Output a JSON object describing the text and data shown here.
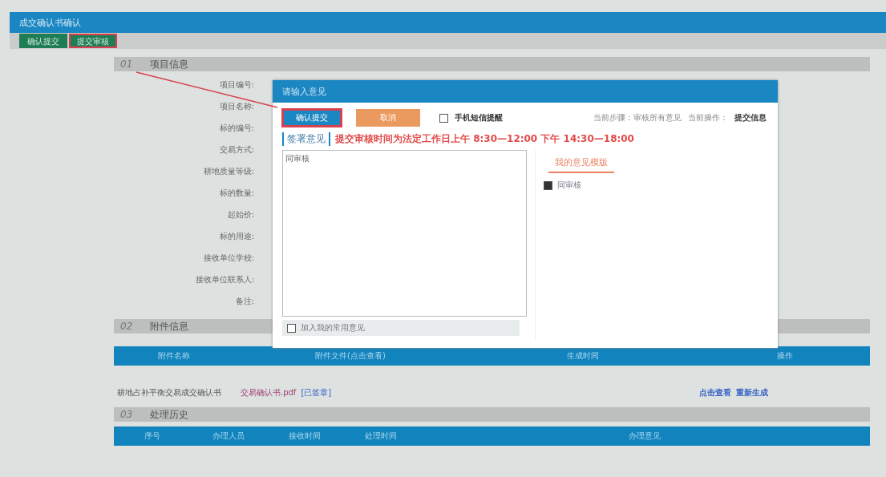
{
  "window": {
    "title": "成交确认书确认"
  },
  "toolbar": {
    "buttons": [
      {
        "label": "确认提交",
        "highlighted": false
      },
      {
        "label": "提交审核",
        "highlighted": true
      }
    ]
  },
  "project_info": {
    "number": "01",
    "title": "项目信息",
    "fields": [
      "项目编号:",
      "项目名称:",
      "标的编号:",
      "交易方式:",
      "耕地质量等级:",
      "标的数量:",
      "起始价:",
      "标的用途:",
      "接收单位学校:",
      "接收单位联系人:",
      "备注:"
    ]
  },
  "attachments": {
    "number": "02",
    "title": "附件信息",
    "columns": [
      "附件名称",
      "附件文件(点击查看)",
      "生成时间",
      "操作"
    ],
    "rows": [
      {
        "name": "耕地占补平衡交易成交确认书",
        "file": "交易确认书.pdf",
        "status": "[已签章]",
        "actions": [
          "点击查看",
          "重新生成"
        ]
      }
    ]
  },
  "history": {
    "number": "03",
    "title": "处理历史",
    "columns": [
      "序号",
      "办理人员",
      "接收时间",
      "处理时间",
      "办理意见"
    ]
  },
  "dialog": {
    "title": "请输入意见",
    "buttons": [
      {
        "label": "确认提交",
        "kind": "primary",
        "highlighted": true
      },
      {
        "label": "取消",
        "kind": "cancel",
        "highlighted": false
      }
    ],
    "sms_reminder": {
      "label": "手机短信提醒",
      "checked": false
    },
    "step_label": "当前步骤：审核所有意见",
    "action_label": "当前操作：",
    "action_value": "提交信息",
    "section_label": "签署意见",
    "notice": "提交审核时间为法定工作日上午 8:30—12:00 下午 14:30—18:00",
    "opinion": {
      "value": "同审核"
    },
    "save_template": {
      "label": "加入我的常用意见",
      "checked": false
    },
    "templates_tab": "我的意见模版",
    "templates": [
      {
        "label": "同审核",
        "checked": true
      }
    ]
  }
}
